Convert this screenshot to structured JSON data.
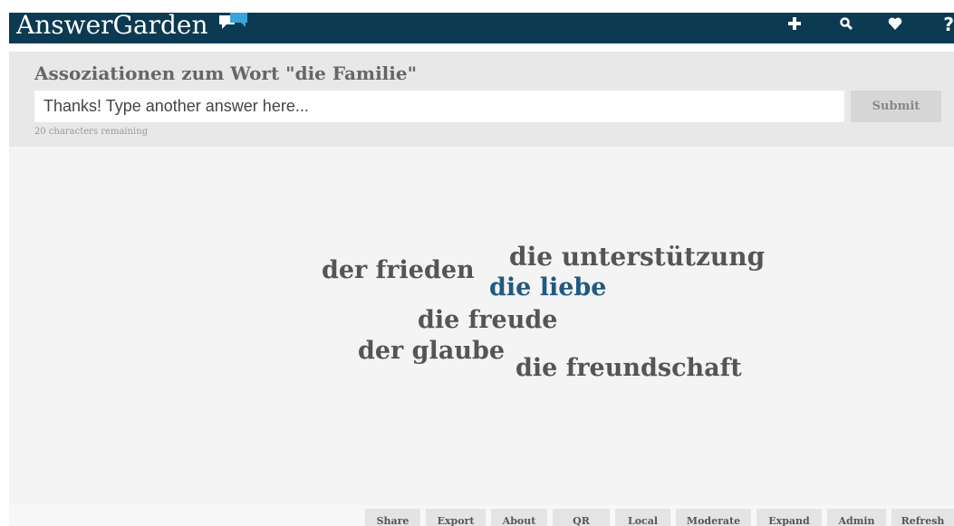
{
  "header": {
    "logo_text": "AnswerGarden",
    "logo_icon": "speech-bubbles-icon",
    "nav": [
      {
        "icon": "plus-icon"
      },
      {
        "icon": "search-icon"
      },
      {
        "icon": "heart-icon"
      },
      {
        "icon": "help-icon",
        "glyph": "?"
      }
    ]
  },
  "question": {
    "title": "Assoziationen zum Wort \"die Familie\"",
    "input_placeholder": "Thanks! Type another answer here...",
    "input_value": "",
    "submit_label": "Submit",
    "chars_remaining": "20 characters remaining"
  },
  "garden": {
    "words": [
      {
        "text": "die unterstützung",
        "highlight": false
      },
      {
        "text": "der frieden",
        "highlight": false
      },
      {
        "text": "die liebe",
        "highlight": true
      },
      {
        "text": "die freude",
        "highlight": false
      },
      {
        "text": "der glaube",
        "highlight": false
      },
      {
        "text": "die freundschaft",
        "highlight": false
      }
    ]
  },
  "footer": {
    "buttons": [
      "Share",
      "Export",
      "About",
      "QR",
      "Local",
      "Moderate",
      "Expand",
      "Admin",
      "Refresh"
    ]
  },
  "colors": {
    "topbar": "#0b3a52",
    "word": "#555555",
    "word_highlight": "#1f5a80"
  }
}
